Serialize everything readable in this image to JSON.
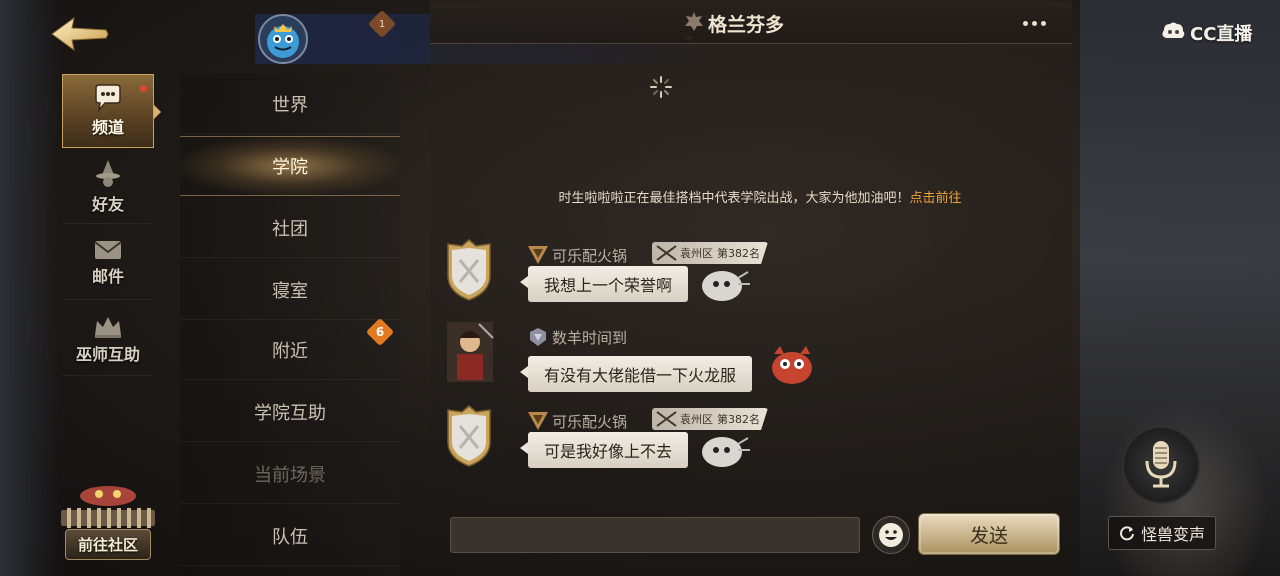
{
  "colors": {
    "accent_gold": "#c9a25d",
    "link_orange": "#f0a23a",
    "badge_orange": "#e27a21",
    "red_dot": "#e0452f"
  },
  "watermark": {
    "text": "CC直播"
  },
  "nav": {
    "items": [
      {
        "label": "频道",
        "icon": "chat-bubble-icon",
        "active": true
      },
      {
        "label": "好友",
        "icon": "wizard-hat-icon"
      },
      {
        "label": "邮件",
        "icon": "envelope-icon"
      },
      {
        "label": "巫师互助",
        "icon": "crown-icon"
      }
    ],
    "community_label": "前往社区"
  },
  "channels": [
    {
      "label": "世界"
    },
    {
      "label": "学院",
      "active": true
    },
    {
      "label": "社团"
    },
    {
      "label": "寝室"
    },
    {
      "label": "附近",
      "badge": "6"
    },
    {
      "label": "学院互助"
    },
    {
      "label": "当前场景",
      "dim": true
    },
    {
      "label": "队伍"
    }
  ],
  "top": {
    "badge": "1"
  },
  "chat": {
    "title": "格兰芬多",
    "system_message": "时生啦啦啦正在最佳搭档中代表学院出战，大家为他加油吧！",
    "system_link": "点击前往",
    "messages": [
      {
        "name": "可乐配火锅",
        "rank_region": "袁州区",
        "rank_pos": "第382名",
        "text": "我想上一个荣誉啊"
      },
      {
        "name": "数羊时间到",
        "text": "有没有大佬能借一下火龙服"
      },
      {
        "name": "可乐配火锅",
        "rank_region": "袁州区",
        "rank_pos": "第382名",
        "text": "可是我好像上不去"
      }
    ],
    "input_value": "",
    "send_label": "发送"
  },
  "voice": {
    "change_label": "怪兽变声"
  }
}
